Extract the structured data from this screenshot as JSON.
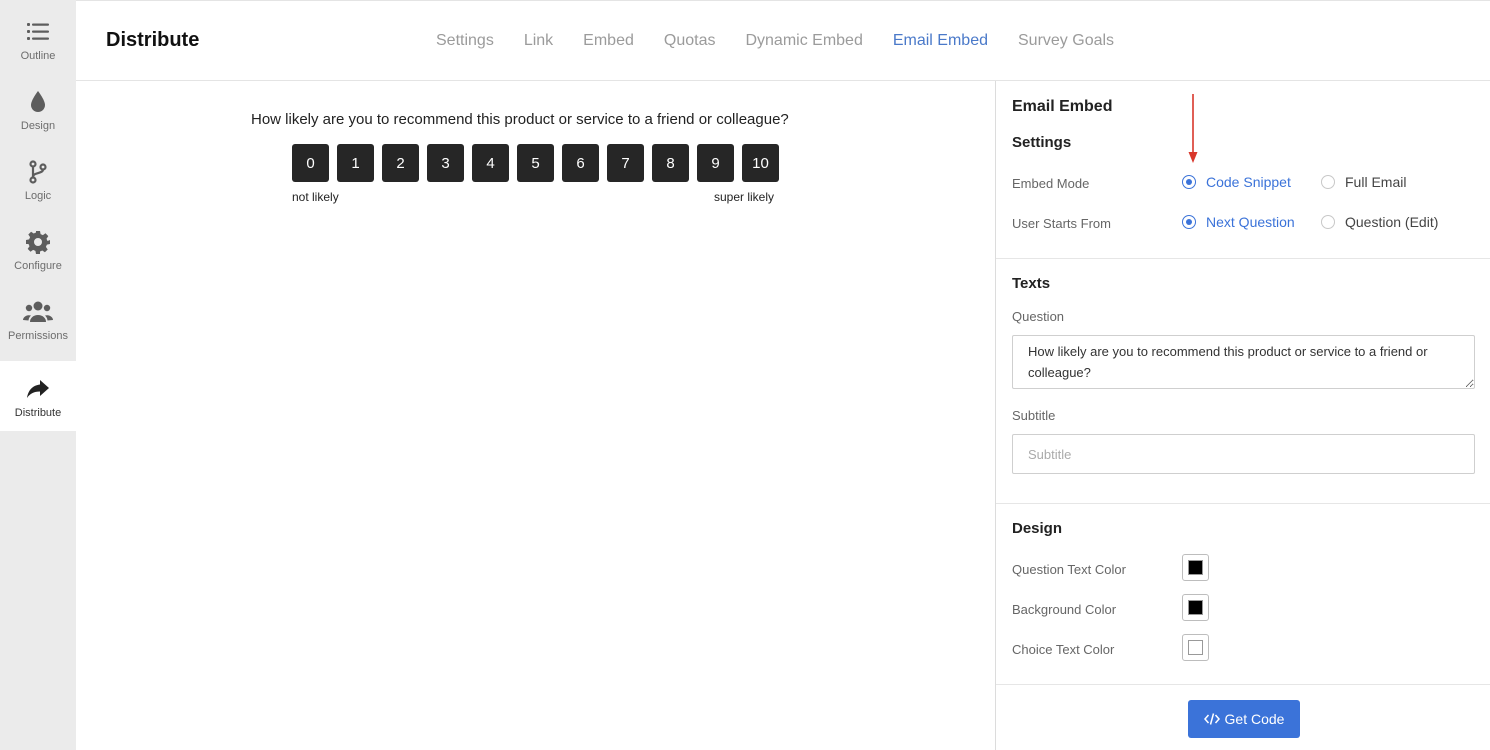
{
  "sidebar": {
    "items": [
      {
        "label": "Outline",
        "icon": "list-icon"
      },
      {
        "label": "Design",
        "icon": "droplet-icon"
      },
      {
        "label": "Logic",
        "icon": "branch-icon"
      },
      {
        "label": "Configure",
        "icon": "gear-icon"
      },
      {
        "label": "Permissions",
        "icon": "users-icon"
      },
      {
        "label": "Distribute",
        "icon": "share-arrow-icon",
        "active": true
      }
    ]
  },
  "header": {
    "title": "Distribute",
    "tabs": [
      {
        "label": "Settings"
      },
      {
        "label": "Link"
      },
      {
        "label": "Embed"
      },
      {
        "label": "Quotas"
      },
      {
        "label": "Dynamic Embed"
      },
      {
        "label": "Email Embed",
        "active": true
      },
      {
        "label": "Survey Goals"
      }
    ]
  },
  "preview": {
    "question": "How likely are you to recommend this product or service to a friend or colleague?",
    "scale": [
      "0",
      "1",
      "2",
      "3",
      "4",
      "5",
      "6",
      "7",
      "8",
      "9",
      "10"
    ],
    "left_label": "not likely",
    "right_label": "super likely"
  },
  "panel": {
    "title": "Email Embed",
    "settings_heading": "Settings",
    "embed_mode": {
      "label": "Embed Mode",
      "options": [
        "Code Snippet",
        "Full Email"
      ],
      "selected": "Code Snippet"
    },
    "user_starts_from": {
      "label": "User Starts From",
      "options": [
        "Next Question",
        "Question (Edit)"
      ],
      "selected": "Next Question"
    },
    "texts_heading": "Texts",
    "question_label": "Question",
    "question_value": "How likely are you to recommend this product or service to a friend or colleague?",
    "subtitle_label": "Subtitle",
    "subtitle_value": "",
    "subtitle_placeholder": "Subtitle",
    "design_heading": "Design",
    "colors": [
      {
        "label": "Question Text Color",
        "value": "#000000"
      },
      {
        "label": "Background Color",
        "value": "#000000"
      },
      {
        "label": "Choice Text Color",
        "value": "#ffffff"
      }
    ],
    "get_code_label": "Get Code"
  },
  "theme": {
    "accent": "#3b73d9",
    "tab_active": "#4a79c9",
    "scale_button_bg": "#262626",
    "annotation_arrow": "#d9372b"
  }
}
